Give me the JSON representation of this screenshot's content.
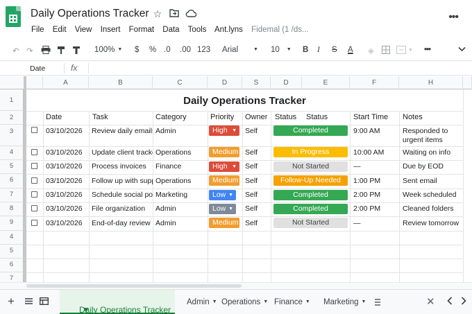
{
  "doc": {
    "title": "Daily Operations Tracker",
    "menu": [
      "File",
      "Edit",
      "View",
      "Insert",
      "Format",
      "Data",
      "Tools",
      "Ant.lyns",
      "Fidemal (1 /ds..."
    ]
  },
  "toolbar": {
    "zoom": "100%",
    "currency": "$",
    "percent": "%",
    "dec_less": ".0",
    "dec_more": ".00",
    "number_format": "123",
    "font": "Arial",
    "font_size": "10",
    "bold": "B",
    "italic": "I",
    "strike": "S",
    "text_color": "A"
  },
  "formula_bar": {
    "name_box": "Date",
    "fx": "fx"
  },
  "columns": [
    "A",
    "B",
    "C",
    "D",
    "S",
    "D",
    "E",
    "F",
    "H"
  ],
  "rows": [
    "1",
    "2",
    "3",
    "4",
    "5",
    "6",
    "7",
    "8",
    "9",
    "4",
    "5",
    "6",
    "7"
  ],
  "sheet_title": "Daily Operations Tracker",
  "headers": [
    "Date",
    "Task",
    "Category",
    "Priority",
    "Owner",
    "Status",
    "Status",
    "Start Time",
    "Notes"
  ],
  "records": [
    {
      "date": "03/10/2026",
      "task": "Review daily emails",
      "category": "Admin",
      "priority": "High",
      "owner": "Self",
      "status": "Completed",
      "start": "9:00 AM",
      "notes": "Responded to",
      "notes2": "urgent items"
    },
    {
      "date": "03/10/2026",
      "task": "Update client tracker",
      "category": "Operations",
      "priority": "Medium",
      "owner": "Self",
      "status": "In Progress",
      "start": "10:00 AM",
      "notes": "Waiting on info",
      "notes2": ""
    },
    {
      "date": "03/10/2026",
      "task": "Process invoices",
      "category": "Finance",
      "priority": "High",
      "owner": "Self",
      "status": "Not Started",
      "start": "—",
      "notes": "Due by EOD",
      "notes2": ""
    },
    {
      "date": "03/10/2026",
      "task": "Follow up with suppliers",
      "category": "Operations",
      "priority": "Medium",
      "owner": "Self",
      "status": "Follow-Up Needed",
      "start": "1:00 PM",
      "notes": "Sent email",
      "notes2": ""
    },
    {
      "date": "03/10/2026",
      "task": "Schedule social posts",
      "category": "Marketing",
      "priority": "Low",
      "owner": "Self",
      "status": "Completed",
      "start": "2:00 PM",
      "notes": "Week scheduled",
      "notes2": ""
    },
    {
      "date": "03/10/2026",
      "task": "File organization",
      "category": "Admin",
      "priority": "Low",
      "owner": "Self",
      "status": "Completed",
      "start": "2:00 PM",
      "notes": "Cleaned folders",
      "notes2": ""
    },
    {
      "date": "03/10/2026",
      "task": "End-of-day review",
      "category": "Admin",
      "priority": "Medium",
      "owner": "Self",
      "status": "Not Started",
      "start": "—",
      "notes": "Review tomorrow",
      "notes2": ""
    }
  ],
  "colors": {
    "completed": "#34a853",
    "in_progress": "#fbbc04",
    "not_started": "#e0e0e0",
    "follow_up": "#f6a100",
    "high": "#dd4b39",
    "medium": "#f29d2f",
    "low": "#4285f4",
    "low_alt": "#7e8a99",
    "active_tab": "#188038"
  },
  "tabs": {
    "active": "Daily Operations Tracker",
    "others": [
      "Admin",
      "Operations",
      "Finance",
      "Marketing"
    ]
  }
}
